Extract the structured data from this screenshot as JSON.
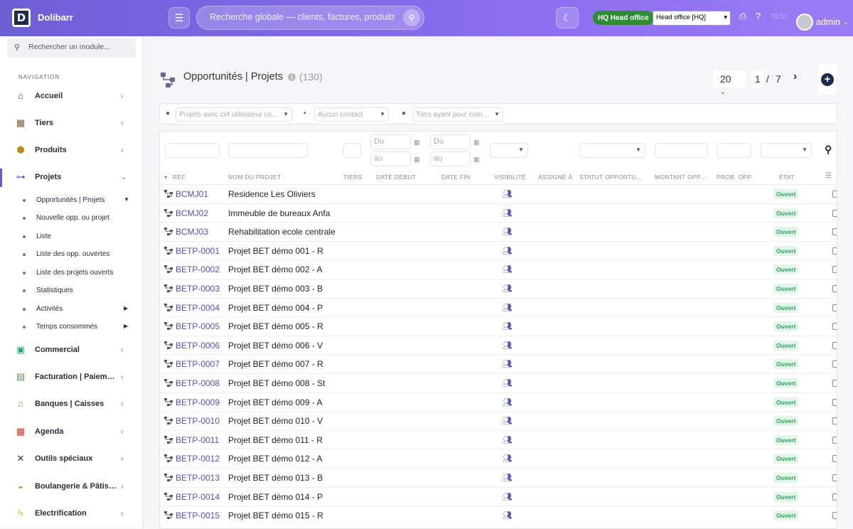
{
  "topbar": {
    "brand": "Dolibarr",
    "logo_letter": "D",
    "search_placeholder": "Recherche globale — clients, factures, produits…",
    "entity_badge": "HQ Head office",
    "entity_select": "Head office [HQ]",
    "faint_text": "TEST",
    "user": "admin"
  },
  "sidebar": {
    "search_placeholder": "Rechercher un module...",
    "nav_label": "NAVIGATION",
    "items": [
      {
        "label": "Accueil",
        "icon": "home-icon"
      },
      {
        "label": "Tiers",
        "icon": "building-icon"
      },
      {
        "label": "Produits",
        "icon": "box-icon"
      },
      {
        "label": "Projets",
        "icon": "project-icon"
      },
      {
        "label": "Commercial",
        "icon": "briefcase-icon"
      },
      {
        "label": "Facturation | Paiements",
        "icon": "invoice-icon"
      },
      {
        "label": "Banques | Caisses",
        "icon": "bank-icon"
      },
      {
        "label": "Agenda",
        "icon": "calendar-icon"
      },
      {
        "label": "Outils spéciaux",
        "icon": "tools-icon"
      },
      {
        "label": "Boulangerie & Pâtisserie",
        "icon": "bread-icon"
      },
      {
        "label": "Electrification",
        "icon": "bolt-icon"
      }
    ],
    "subitems": [
      "Opportunités | Projets",
      "Nouvelle opp. ou projet",
      "Liste",
      "Liste des opp. ouvertes",
      "Liste des projets ouverts",
      "Statistiques",
      "Activités",
      "Temps consommés"
    ]
  },
  "page": {
    "title": "Opportunités | Projets",
    "count": "(130)",
    "per_page": "20",
    "page_current": "1",
    "page_sep": "/",
    "page_total": "7"
  },
  "filters": {
    "user_projects": "Projets avec cet utilisateur comme contact",
    "contact": "Aucun contact",
    "thirdparty": "Tiers ayant pour commercial"
  },
  "date_filters": {
    "from": "Du",
    "to": "au"
  },
  "table": {
    "headers": [
      "RÉF.",
      "NOM DU PROJET",
      "TIERS",
      "DATE DÉBUT",
      "DATE FIN",
      "VISIBILITÉ",
      "ASSIGNÉ À",
      "STATUT OPPORTUNITÉ",
      "MONTANT OPPORTUNITÉ",
      "PROB. OPP.",
      "ÉTAT"
    ],
    "rows": [
      {
        "ref": "BCMJ01",
        "name": "Residence Les Oliviers",
        "status": "Ouvert"
      },
      {
        "ref": "BCMJ02",
        "name": "Immeuble de bureaux Anfa",
        "status": "Ouvert"
      },
      {
        "ref": "BCMJ03",
        "name": "Rehabilitation ecole centrale",
        "status": "Ouvert"
      },
      {
        "ref": "BETP-0001",
        "name": "Projet BET démo 001 - R",
        "status": "Ouvert"
      },
      {
        "ref": "BETP-0002",
        "name": "Projet BET démo 002 - A",
        "status": "Ouvert"
      },
      {
        "ref": "BETP-0003",
        "name": "Projet BET démo 003 - B",
        "status": "Ouvert"
      },
      {
        "ref": "BETP-0004",
        "name": "Projet BET démo 004 - P",
        "status": "Ouvert"
      },
      {
        "ref": "BETP-0005",
        "name": "Projet BET démo 005 - R",
        "status": "Ouvert"
      },
      {
        "ref": "BETP-0006",
        "name": "Projet BET démo 006 - V",
        "status": "Ouvert"
      },
      {
        "ref": "BETP-0007",
        "name": "Projet BET démo 007 - R",
        "status": "Ouvert"
      },
      {
        "ref": "BETP-0008",
        "name": "Projet BET démo 008 - St",
        "status": "Ouvert"
      },
      {
        "ref": "BETP-0009",
        "name": "Projet BET démo 009 - A",
        "status": "Ouvert"
      },
      {
        "ref": "BETP-0010",
        "name": "Projet BET démo 010 - V",
        "status": "Ouvert"
      },
      {
        "ref": "BETP-0011",
        "name": "Projet BET démo 011 - R",
        "status": "Ouvert"
      },
      {
        "ref": "BETP-0012",
        "name": "Projet BET démo 012 - A",
        "status": "Ouvert"
      },
      {
        "ref": "BETP-0013",
        "name": "Projet BET démo 013 - B",
        "status": "Ouvert"
      },
      {
        "ref": "BETP-0014",
        "name": "Projet BET démo 014 - P",
        "status": "Ouvert"
      },
      {
        "ref": "BETP-0015",
        "name": "Projet BET démo 015 - R",
        "status": "Ouvert"
      }
    ]
  },
  "colors": {
    "accent": "#6d5fd6",
    "link": "#5b4dbd",
    "status_open": "#2ea05a",
    "hq_badge": "#2e8b36"
  }
}
